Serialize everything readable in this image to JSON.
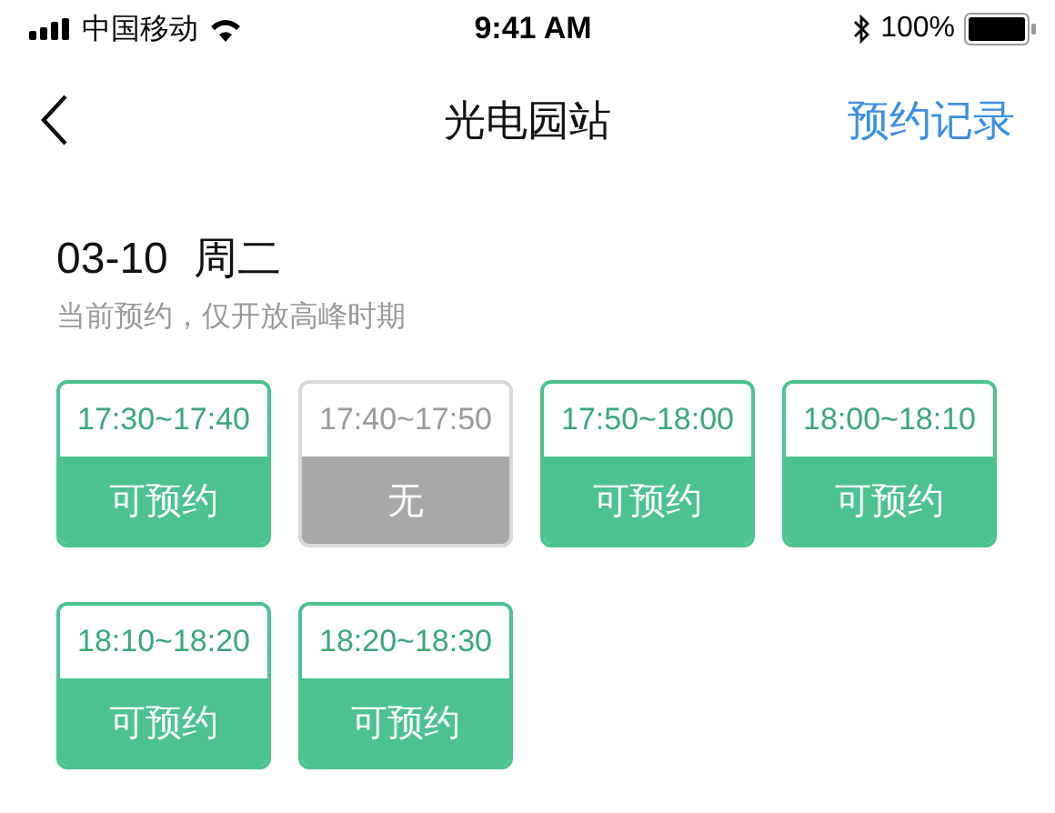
{
  "status_bar": {
    "carrier": "中国移动",
    "time": "9:41 AM",
    "battery": "100%"
  },
  "nav_bar": {
    "title": "光电园站",
    "action": "预约记录"
  },
  "day": {
    "date": "03-10",
    "weekday": "周二",
    "note": "当前预约，仅开放高峰时期"
  },
  "slots": [
    {
      "time": "17:30~17:40",
      "status": "可预约",
      "disabled": false
    },
    {
      "time": "17:40~17:50",
      "status": "无",
      "disabled": true
    },
    {
      "time": "17:50~18:00",
      "status": "可预约",
      "disabled": false
    },
    {
      "time": "18:00~18:10",
      "status": "可预约",
      "disabled": false
    },
    {
      "time": "18:10~18:20",
      "status": "可预约",
      "disabled": false
    },
    {
      "time": "18:20~18:30",
      "status": "可预约",
      "disabled": false
    }
  ]
}
